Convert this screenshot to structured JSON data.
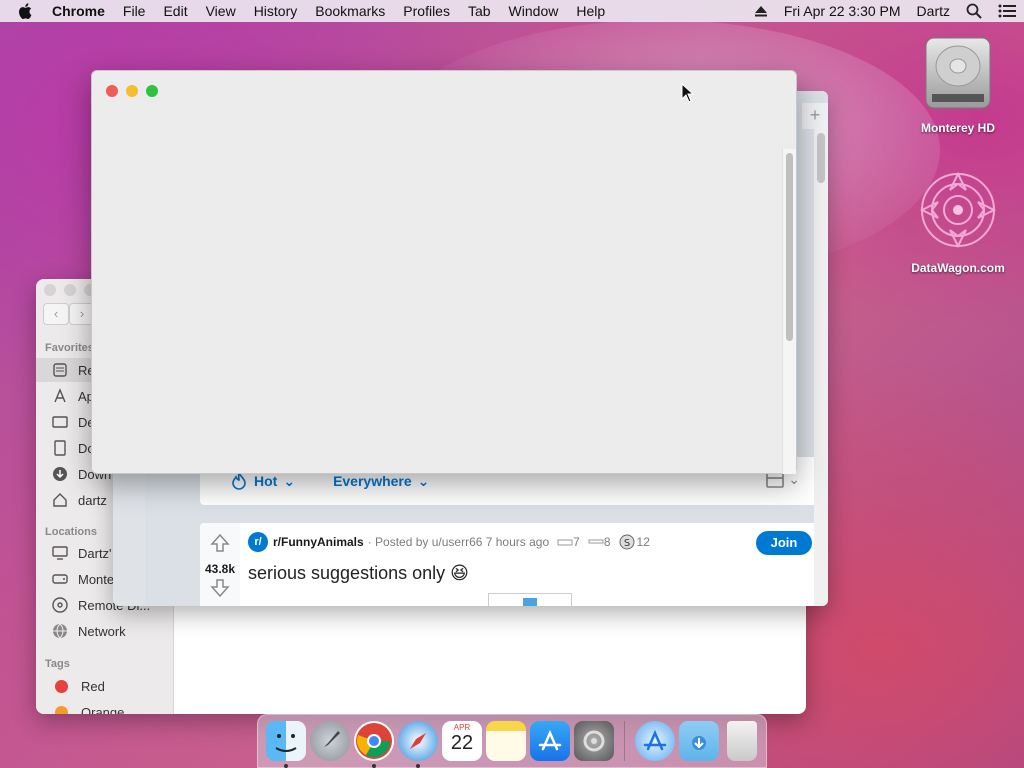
{
  "menubar": {
    "app": "Chrome",
    "items": [
      "File",
      "Edit",
      "View",
      "History",
      "Bookmarks",
      "Profiles",
      "Tab",
      "Window",
      "Help"
    ],
    "datetime": "Fri Apr 22  3:30 PM",
    "user": "Dartz"
  },
  "desktop": {
    "icons": [
      {
        "label": "Monterey HD",
        "icon": "hard-drive-icon"
      },
      {
        "label": "DataWagon.com",
        "icon": "mandala-icon"
      }
    ]
  },
  "finder": {
    "sections": {
      "favorites": "Favorites",
      "locations": "Locations",
      "tags": "Tags"
    },
    "favorites": [
      {
        "label": "Re",
        "icon": "recents-icon",
        "selected": true
      },
      {
        "label": "Ap",
        "icon": "applications-icon"
      },
      {
        "label": "De",
        "icon": "desktop-icon"
      },
      {
        "label": "Do",
        "icon": "documents-icon"
      },
      {
        "label": "Down",
        "icon": "downloads-icon"
      },
      {
        "label": "dartz",
        "icon": "home-icon"
      }
    ],
    "locations": [
      {
        "label": "Dartz'",
        "icon": "computer-icon"
      },
      {
        "label": "Monte",
        "icon": "disk-icon"
      },
      {
        "label": "Remote Di...",
        "icon": "remote-disc-icon"
      },
      {
        "label": "Network",
        "icon": "network-icon"
      }
    ],
    "tags": [
      {
        "label": "Red",
        "color": "#e5413f"
      },
      {
        "label": "Orange",
        "color": "#f39c2b"
      }
    ]
  },
  "chrome": {
    "sort": {
      "hot": "Hot",
      "everywhere": "Everywhere"
    },
    "post": {
      "votes": "43.8k",
      "subreddit": "r/FunnyAnimals",
      "subreddit_icon": "r/",
      "posted_by": "· Posted by u/userr66 7 hours ago",
      "award1": "7",
      "award2": "8",
      "award3": "12",
      "title": "serious suggestions only 😆",
      "join": "Join"
    }
  },
  "colors": {
    "reddit_blue": "#0079d3",
    "close": "#ee5e55",
    "minimize": "#f5bd2f",
    "zoom": "#2fc340"
  },
  "dock": {
    "apps": [
      "finder-icon",
      "launchpad-icon",
      "chrome-icon",
      "safari-icon",
      "calendar-icon",
      "notes-icon",
      "app-store-icon",
      "system-preferences-icon",
      "app-store-icon",
      "downloads-folder-icon",
      "trash-icon"
    ],
    "calendar": {
      "month": "APR",
      "day": "22"
    }
  }
}
